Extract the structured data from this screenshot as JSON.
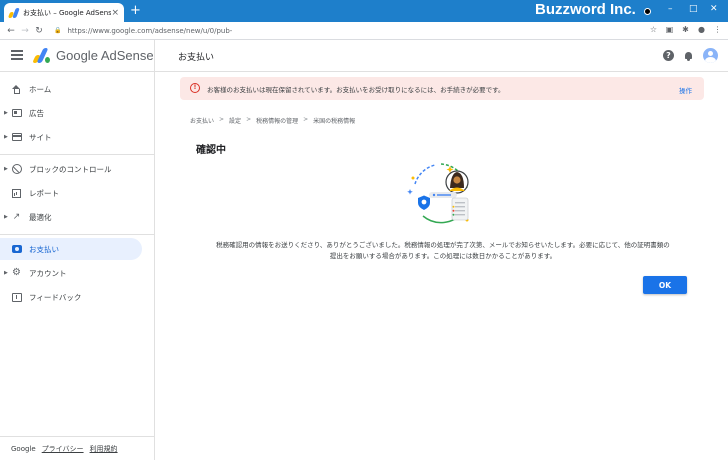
{
  "browser": {
    "tab_title": "お支払い – Google AdSense",
    "tab_close": "×",
    "new_tab": "+",
    "url": "https://www.google.com/adsense/new/u/0/pub-",
    "watermark": "Buzzword Inc.",
    "window_controls": {
      "minimize": "–",
      "maximize": "□",
      "close": "✕"
    }
  },
  "app": {
    "brand": "Google AdSense",
    "page_title": "お支払い",
    "help": "?"
  },
  "sidebar": {
    "items": [
      {
        "label": "ホーム",
        "icon": "home-icon",
        "expandable": false,
        "active": false
      },
      {
        "label": "広告",
        "icon": "ads-icon",
        "expandable": true,
        "active": false
      },
      {
        "label": "サイト",
        "icon": "sites-icon",
        "expandable": true,
        "active": false
      },
      {
        "label": "ブロックのコントロール",
        "icon": "block-icon",
        "expandable": true,
        "active": false
      },
      {
        "label": "レポート",
        "icon": "report-icon",
        "expandable": false,
        "active": false
      },
      {
        "label": "最適化",
        "icon": "trending-icon",
        "expandable": true,
        "active": false
      },
      {
        "label": "お支払い",
        "icon": "payments-icon",
        "expandable": false,
        "active": true
      },
      {
        "label": "アカウント",
        "icon": "gear-icon",
        "expandable": true,
        "active": false
      },
      {
        "label": "フィードバック",
        "icon": "feedback-icon",
        "expandable": false,
        "active": false
      }
    ],
    "footer": {
      "brand": "Google",
      "privacy": "プライバシー",
      "terms": "利用規約"
    }
  },
  "alert": {
    "icon": "!",
    "text": "お客様のお支払いは現在保留されています。お支払いをお受け取りになるには、お手続きが必要です。",
    "action": "操作"
  },
  "breadcrumb": {
    "items": [
      "お支払い",
      "設定",
      "税務情報の管理",
      "米国の税務情報"
    ],
    "separator": ">"
  },
  "content": {
    "title": "確認中",
    "description_line1": "税務確認用の情報をお送りくださり、ありがとうございました。税務情報の処理が完了次第、メールでお知らせいたします。必要に応じて、他の証明書類の",
    "description_line2": "提出をお願いする場合があります。この処理には数日かかることがあります。",
    "ok_label": "OK"
  },
  "colors": {
    "chrome_blue": "#1e7fcb",
    "accent": "#1a73e8",
    "alert_bg": "#fce8e6",
    "alert_icon": "#d93025",
    "active_nav_bg": "#e8f0fe"
  }
}
